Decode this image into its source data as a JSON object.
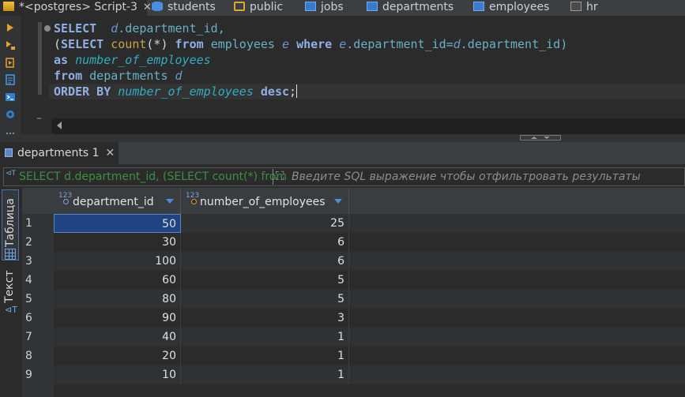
{
  "editor_tabs": [
    {
      "label": "*<postgres> Script-3",
      "icon": "sql-script-icon",
      "closable": true,
      "active": true
    },
    {
      "label": "students",
      "icon": "database-icon"
    },
    {
      "label": "public",
      "icon": "schema-folder-icon"
    },
    {
      "label": "jobs",
      "icon": "table-icon"
    },
    {
      "label": "departments",
      "icon": "table-icon"
    },
    {
      "label": "employees",
      "icon": "table-icon"
    },
    {
      "label": "hr",
      "icon": "document-icon"
    }
  ],
  "sql": {
    "l1_kw": "SELECT",
    "l1_alias": "d",
    "l1_rest": ".department_id,",
    "l2_open": "(",
    "l2_select": "SELECT",
    "l2_count": "count",
    "l2_args": "(*)",
    "l2_from": "from",
    "l2_table": "employees",
    "l2_alias": "e",
    "l2_where": "where",
    "l2_e": "e",
    "l2_col": ".department_id=",
    "l2_d": "d",
    "l2_col2": ".department_id)",
    "l3_as": "as",
    "l3_alias": "number_of_employees",
    "l4_from": "from",
    "l4_table": "departments",
    "l4_alias": "d",
    "l5_order": "ORDER BY",
    "l5_alias": "number_of_employees",
    "l5_desc": "desc",
    "l5_end": ";"
  },
  "result_tab": {
    "label": "departments 1",
    "close": "✕"
  },
  "filter": {
    "prefix": "⊲T",
    "sql_preview": "SELECT d.department_id, (SELECT count(*) from",
    "placeholder": "Введите SQL выражение чтобы отфильтровать результаты"
  },
  "view_tabs": {
    "table": "Таблица",
    "text": "Текст"
  },
  "columns": [
    {
      "badge": "123",
      "label": "department_id",
      "key": "primary"
    },
    {
      "badge": "123",
      "label": "number_of_employees",
      "key": "computed"
    }
  ],
  "rows": [
    {
      "n": "1",
      "department_id": "50",
      "number_of_employees": "25"
    },
    {
      "n": "2",
      "department_id": "30",
      "number_of_employees": "6"
    },
    {
      "n": "3",
      "department_id": "100",
      "number_of_employees": "6"
    },
    {
      "n": "4",
      "department_id": "60",
      "number_of_employees": "5"
    },
    {
      "n": "5",
      "department_id": "80",
      "number_of_employees": "5"
    },
    {
      "n": "6",
      "department_id": "90",
      "number_of_employees": "3"
    },
    {
      "n": "7",
      "department_id": "40",
      "number_of_employees": "1"
    },
    {
      "n": "8",
      "department_id": "20",
      "number_of_employees": "1"
    },
    {
      "n": "9",
      "department_id": "10",
      "number_of_employees": "1"
    }
  ],
  "colors": {
    "selection": "#214283",
    "keyword": "#8fb0e6",
    "function": "#c9a24a",
    "alias": "#2eaec0"
  }
}
